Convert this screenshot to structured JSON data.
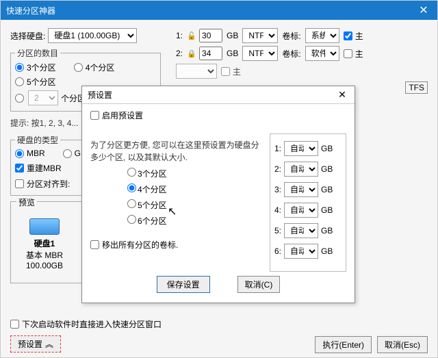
{
  "window": {
    "title": "快速分区神器",
    "close": "✕"
  },
  "disk_select": {
    "label": "选择硬盘:",
    "value": "硬盘1 (100.00GB)"
  },
  "count_group": {
    "legend": "分区的数目",
    "opt3": "3个分区",
    "opt5": "5个分区",
    "opt4": "4个分区",
    "custom_count": "2",
    "custom_suffix": "个分区"
  },
  "hint": "提示: 按1, 2, 3, 4...",
  "disk_type": {
    "legend": "硬盘的类型",
    "mbr": "MBR",
    "gpt": "GPT",
    "rebuild": "重建MBR",
    "align": "分区对齐到:"
  },
  "parts": {
    "r1": {
      "idx": "1:",
      "lock": "🔓",
      "size": "30",
      "gb": "GB",
      "fs": "NTFS",
      "vol_l": "卷标:",
      "vol": "系统",
      "pri": "主"
    },
    "r2": {
      "idx": "2:",
      "lock": "🔒",
      "size": "34",
      "gb": "GB",
      "fs": "NTFS",
      "vol_l": "卷标:",
      "vol": "软件",
      "pri": "主"
    }
  },
  "preview": {
    "legend": "预览",
    "disk_name": "硬盘1",
    "disk_sub1": "基本 MBR",
    "disk_sub2": "100.00GB",
    "tfs_tag": "TFS"
  },
  "bottom": {
    "auto_enter": "下次启动软件时直接进入快速分区窗口",
    "preset_btn": "预设置",
    "chevron": "︽",
    "exec": "执行(Enter)",
    "cancel": "取消(Esc)"
  },
  "dialog": {
    "title": "预设置",
    "close": "✕",
    "enable": "启用预设置",
    "note": "为了分区更方便, 您可以在这里预设置为硬盘分多少个区, 以及其默认大小.",
    "o3": "3个分区",
    "o4": "4个分区",
    "o5": "5个分区",
    "o6": "6个分区",
    "clear_vol": "移出所有分区的卷标.",
    "save": "保存设置",
    "cancel": "取消(C)",
    "rows": {
      "r1": {
        "l": "1:",
        "v": "自动",
        "u": "GB"
      },
      "r2": {
        "l": "2:",
        "v": "自动",
        "u": "GB"
      },
      "r3": {
        "l": "3:",
        "v": "自动",
        "u": "GB"
      },
      "r4": {
        "l": "4:",
        "v": "自动",
        "u": "GB"
      },
      "r5": {
        "l": "5:",
        "v": "自动",
        "u": "GB"
      },
      "r6": {
        "l": "6:",
        "v": "自动",
        "u": "GB"
      }
    }
  }
}
